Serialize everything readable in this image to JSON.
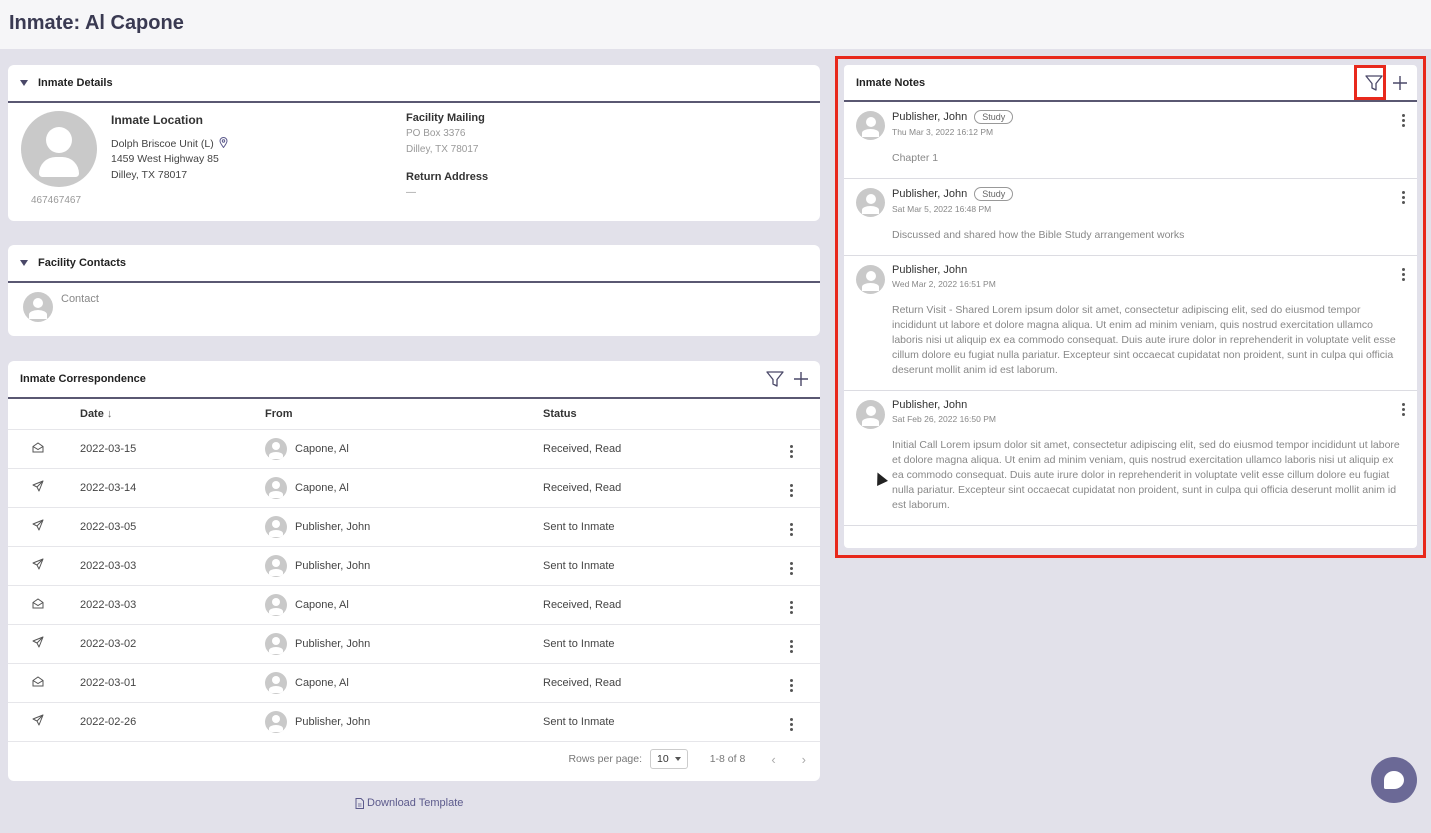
{
  "page": {
    "title": "Inmate: Al Capone"
  },
  "details": {
    "header": "Inmate Details",
    "inmate_id": "467467467",
    "location_title": "Inmate Location",
    "facility_name": "Dolph Briscoe Unit (L)",
    "address1": "1459 West Highway 85",
    "address2": "Dilley, TX 78017",
    "mailing_title": "Facility Mailing",
    "mailing1": "PO Box 3376",
    "mailing2": "Dilley, TX 78017",
    "return_title": "Return Address",
    "return_value": "—"
  },
  "contacts": {
    "header": "Facility Contacts",
    "contact_label": "Contact"
  },
  "correspondence": {
    "header": "Inmate Correspondence",
    "columns": {
      "date": "Date",
      "from": "From",
      "status": "Status"
    },
    "rows": [
      {
        "type": "received",
        "date": "2022-03-15",
        "from": "Capone, Al",
        "status": "Received, Read"
      },
      {
        "type": "sent",
        "date": "2022-03-14",
        "from": "Capone, Al",
        "status": "Received, Read"
      },
      {
        "type": "sent",
        "date": "2022-03-05",
        "from": "Publisher, John",
        "status": "Sent to Inmate"
      },
      {
        "type": "sent",
        "date": "2022-03-03",
        "from": "Publisher, John",
        "status": "Sent to Inmate"
      },
      {
        "type": "received",
        "date": "2022-03-03",
        "from": "Capone, Al",
        "status": "Received, Read"
      },
      {
        "type": "sent",
        "date": "2022-03-02",
        "from": "Publisher, John",
        "status": "Sent to Inmate"
      },
      {
        "type": "received",
        "date": "2022-03-01",
        "from": "Capone, Al",
        "status": "Received, Read"
      },
      {
        "type": "sent",
        "date": "2022-02-26",
        "from": "Publisher, John",
        "status": "Sent to Inmate"
      }
    ],
    "pager": {
      "rows_label": "Rows per page:",
      "rows_value": "10",
      "range": "1-8 of 8"
    },
    "download_label": "Download Template"
  },
  "notes": {
    "header": "Inmate Notes",
    "items": [
      {
        "author": "Publisher, John",
        "chip": "Study",
        "date": "Thu Mar 3, 2022 16:12 PM",
        "body": "Chapter 1"
      },
      {
        "author": "Publisher, John",
        "chip": "Study",
        "date": "Sat Mar 5, 2022 16:48 PM",
        "body": "Discussed and shared how the Bible Study arrangement works"
      },
      {
        "author": "Publisher, John",
        "chip": "",
        "date": "Wed Mar 2, 2022 16:51 PM",
        "body": "Return Visit - Shared Lorem ipsum dolor sit amet, consectetur adipiscing elit, sed do eiusmod tempor incididunt ut labore et dolore magna aliqua. Ut enim ad minim veniam, quis nostrud exercitation ullamco laboris nisi ut aliquip ex ea commodo consequat. Duis aute irure dolor in reprehenderit in voluptate velit esse cillum dolore eu fugiat nulla pariatur. Excepteur sint occaecat cupidatat non proident, sunt in culpa qui officia deserunt mollit anim id est laborum."
      },
      {
        "author": "Publisher, John",
        "chip": "",
        "date": "Sat Feb 26, 2022 16:50 PM",
        "body": "Initial Call Lorem ipsum dolor sit amet, consectetur adipiscing elit, sed do eiusmod tempor incididunt ut labore et dolore magna aliqua. Ut enim ad minim veniam, quis nostrud exercitation ullamco laboris nisi ut aliquip ex ea commodo consequat. Duis aute irure dolor in reprehenderit in voluptate velit esse cillum dolore eu fugiat nulla pariatur. Excepteur sint occaecat cupidatat non proident, sunt in culpa qui officia deserunt mollit anim id est laborum."
      }
    ]
  },
  "colors": {
    "accent": "#5c5a8c",
    "highlight": "#e8291c",
    "background": "#e2e1ea"
  },
  "icons": {
    "filter": "filter-icon",
    "add": "plus-icon",
    "envelope": "envelope-open-icon",
    "send": "send-icon",
    "chat": "chat-icon"
  }
}
